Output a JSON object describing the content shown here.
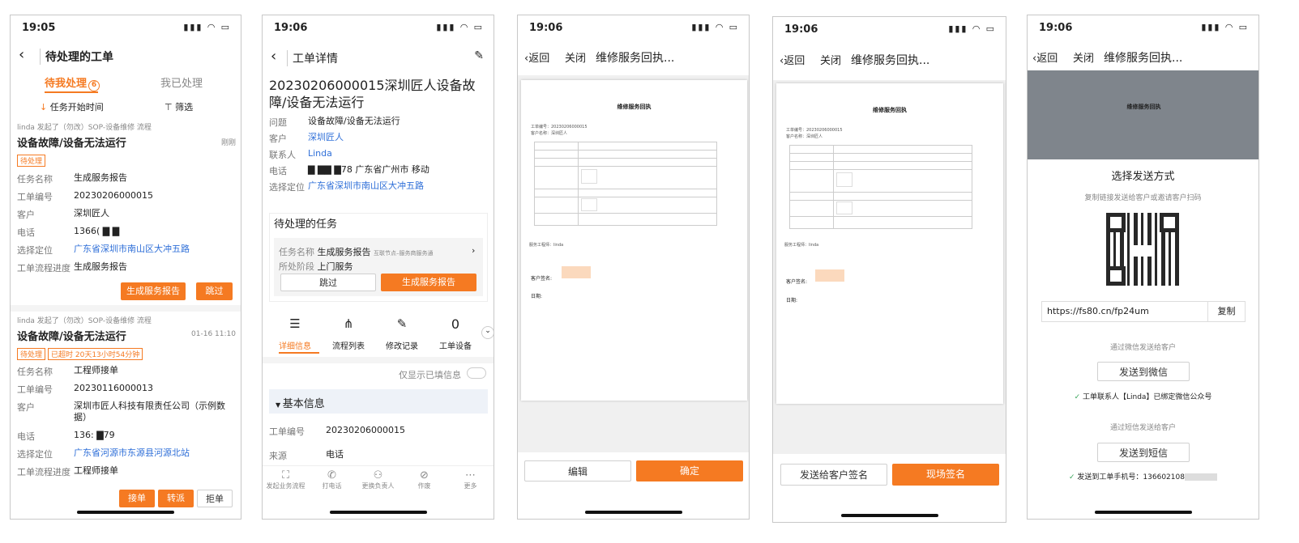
{
  "p1": {
    "time": "19:05",
    "title": "待处理的工单",
    "tab1": "待我处理",
    "tab1_badge": "6",
    "tab2": "我已处理",
    "sort": "任务开始时间",
    "filter": "筛选",
    "card1": {
      "initiator": "linda 发起了（勿改）SOP-设备维修 流程",
      "title": "设备故障/设备无法运行",
      "time": "刚刚",
      "tag": "待处理",
      "rows": [
        [
          "任务名称",
          "生成服务报告"
        ],
        [
          "工单编号",
          "20230206000015"
        ],
        [
          "客户",
          "深圳匠人"
        ],
        [
          "电话",
          "1366( ▇ ▇"
        ],
        [
          "选择定位",
          "广东省深圳市南山区大冲五路"
        ],
        [
          "工单流程进度",
          "生成服务报告"
        ]
      ],
      "btn_primary": "生成服务报告",
      "btn_skip": "跳过"
    },
    "card2": {
      "initiator": "linda 发起了（勿改）SOP-设备维修 流程",
      "title": "设备故障/设备无法运行",
      "time": "01-16 11:10",
      "tag": "待处理",
      "tag2": "已超时 20天13小时54分钟",
      "rows": [
        [
          "任务名称",
          "工程师接单"
        ],
        [
          "工单编号",
          "20230116000013"
        ],
        [
          "客户",
          "深圳市匠人科技有限责任公司（示例数据）"
        ],
        [
          "电话",
          "136: ▇79"
        ],
        [
          "选择定位",
          "广东省河源市东源县河源北站"
        ],
        [
          "工单流程进度",
          "工程师接单"
        ]
      ],
      "btn_accept": "接单",
      "btn_transfer": "转派",
      "btn_reject": "拒单"
    }
  },
  "p2": {
    "time": "19:06",
    "title": "工单详情",
    "heading": "20230206000015深圳匠人设备故障/设备无法运行",
    "rows": [
      [
        "问题",
        "设备故障/设备无法运行"
      ],
      [
        "客户",
        "深圳匠人"
      ],
      [
        "联系人",
        "Linda"
      ],
      [
        "电话",
        "▇ ▇▇ ▇78 广东省广州市 移动"
      ],
      [
        "选择定位",
        "广东省深圳市南山区大冲五路"
      ]
    ],
    "pending_title": "待处理的任务",
    "task_label": "任务名称",
    "task_name": "生成服务报告",
    "task_node": "互联节点–服务商服务通",
    "stage_label": "所处阶段",
    "stage": "上门服务",
    "skip": "跳过",
    "gen": "生成服务报告",
    "tabs": [
      "详细信息",
      "流程列表",
      "修改记录",
      "工单设备"
    ],
    "device_count": "0",
    "only_filled": "仅显示已填信息",
    "section": "基本信息",
    "fields": [
      [
        "工单编号",
        "20230206000015"
      ],
      [
        "来源",
        "电话"
      ]
    ],
    "bottom": [
      "发起业务流程",
      "打电话",
      "更换负责人",
      "作废",
      "更多"
    ]
  },
  "p3": {
    "time": "19:06",
    "back": "返回",
    "close": "关闭",
    "title": "维修服务回执...",
    "doc_title": "维修服务回执",
    "sign": "客户签名:",
    "date": "日期:",
    "btn_edit": "编辑",
    "btn_ok": "确定"
  },
  "p4": {
    "time": "19:06",
    "back": "返回",
    "close": "关闭",
    "title": "维修服务回执...",
    "doc_title": "维修服务回执",
    "sign": "客户签名:",
    "date": "日期:",
    "btn_send": "发送给客户签名",
    "btn_sign": "现场签名"
  },
  "p5": {
    "time": "19:06",
    "back": "返回",
    "close": "关闭",
    "title": "维修服务回执...",
    "doc_title": "维修服务回执",
    "choose": "选择发送方式",
    "hint": "复制链接发送给客户或邀请客户扫码",
    "url": "https://fs80.cn/fp24um",
    "copy": "复制",
    "wx_hint": "通过微信发送给客户",
    "wx_btn": "发送到微信",
    "wx_note": "工单联系人【Linda】已绑定微信公众号",
    "sms_hint": "通过短信发送给客户",
    "sms_btn": "发送到短信",
    "sms_note": "发送到工单手机号：136602108"
  }
}
